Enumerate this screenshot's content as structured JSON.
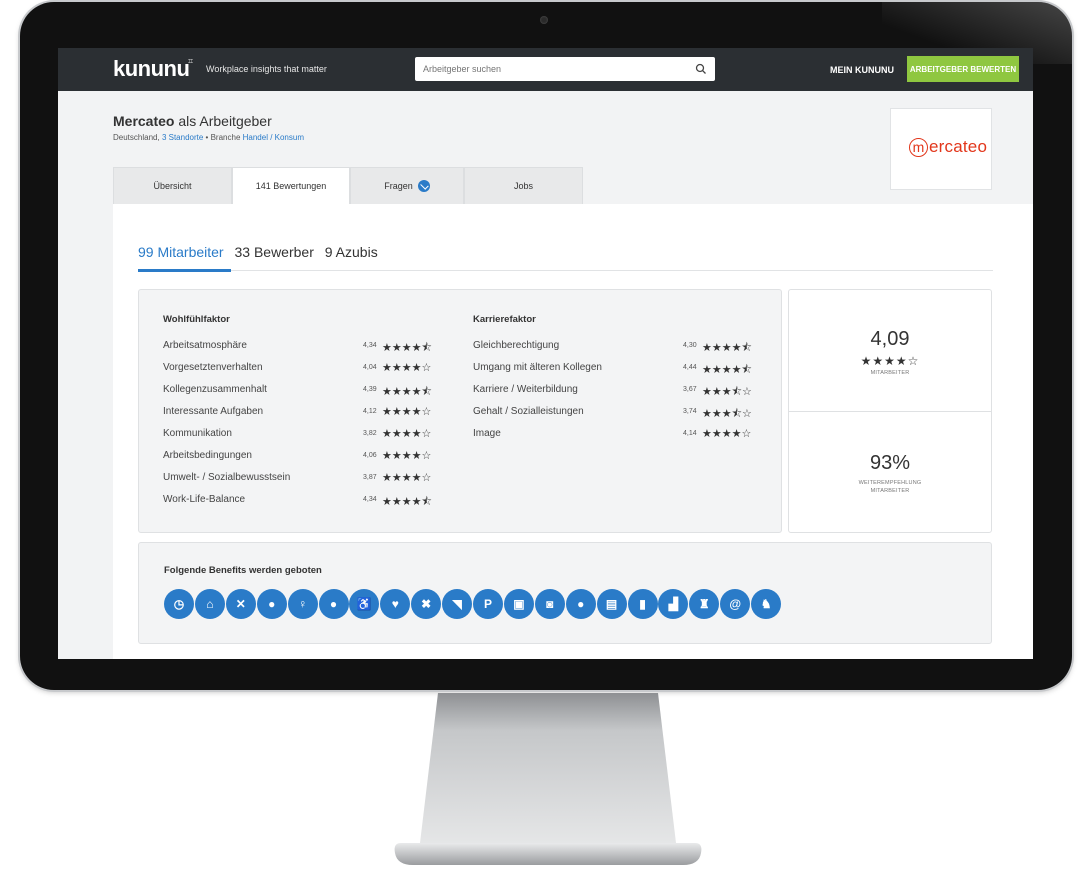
{
  "topbar": {
    "logo": "kununu",
    "logo_mark": "⌗",
    "tagline": "Workplace insights that matter",
    "search_placeholder": "Arbeitgeber suchen",
    "mein_kununu": "MEIN KUNUNU",
    "cta": "ARBEITGEBER BEWERTEN"
  },
  "company": {
    "name": "Mercateo",
    "suffix": "als Arbeitgeber",
    "country": "Deutschland,",
    "standorte": "3 Standorte",
    "separator": "•",
    "branche_label": "Branche",
    "branche": "Handel / Konsum",
    "logo_text": "ercateo",
    "logo_initial": "m"
  },
  "tabs": [
    {
      "label": "Übersicht"
    },
    {
      "label": "141 Bewertungen"
    },
    {
      "label": "Fragen"
    },
    {
      "label": "Jobs"
    }
  ],
  "subtabs": [
    {
      "label": "99 Mitarbeiter"
    },
    {
      "label": "33 Bewerber"
    },
    {
      "label": "9 Azubis"
    }
  ],
  "wohlfuehl": {
    "title": "Wohlfühlfaktor",
    "rows": [
      {
        "name": "Arbeitsatmosphäre",
        "value": "4,34",
        "stars": "★★★★⯪"
      },
      {
        "name": "Vorgesetztenverhalten",
        "value": "4,04",
        "stars": "★★★★☆"
      },
      {
        "name": "Kollegenzusammenhalt",
        "value": "4,39",
        "stars": "★★★★⯪"
      },
      {
        "name": "Interessante Aufgaben",
        "value": "4,12",
        "stars": "★★★★☆"
      },
      {
        "name": "Kommunikation",
        "value": "3,82",
        "stars": "★★★★☆"
      },
      {
        "name": "Arbeitsbedingungen",
        "value": "4,06",
        "stars": "★★★★☆"
      },
      {
        "name": "Umwelt- / Sozialbewusstsein",
        "value": "3,87",
        "stars": "★★★★☆"
      },
      {
        "name": "Work-Life-Balance",
        "value": "4,34",
        "stars": "★★★★⯪"
      }
    ]
  },
  "karriere": {
    "title": "Karrierefaktor",
    "rows": [
      {
        "name": "Gleichberechtigung",
        "value": "4,30",
        "stars": "★★★★⯪"
      },
      {
        "name": "Umgang mit älteren Kollegen",
        "value": "4,44",
        "stars": "★★★★⯪"
      },
      {
        "name": "Karriere / Weiterbildung",
        "value": "3,67",
        "stars": "★★★⯪☆"
      },
      {
        "name": "Gehalt / Sozialleistungen",
        "value": "3,74",
        "stars": "★★★⯪☆"
      },
      {
        "name": "Image",
        "value": "4,14",
        "stars": "★★★★☆"
      }
    ]
  },
  "overall": {
    "score": "4,09",
    "stars": "★★★★☆",
    "caption": "MITARBEITER",
    "recommend": "93%",
    "recommend_caption_1": "WEITEREMPFEHLUNG",
    "recommend_caption_2": "MITARBEITER"
  },
  "benefits": {
    "title": "Folgende Benefits werden geboten",
    "items": [
      {
        "icon": "clock-icon",
        "glyph": "◷"
      },
      {
        "icon": "home-icon",
        "glyph": "⌂"
      },
      {
        "icon": "cutlery-icon",
        "glyph": "✕"
      },
      {
        "icon": "health-icon",
        "glyph": "●"
      },
      {
        "icon": "childcare-icon",
        "glyph": "♀"
      },
      {
        "icon": "piggybank-icon",
        "glyph": "●"
      },
      {
        "icon": "accessibility-icon",
        "glyph": "♿"
      },
      {
        "icon": "heart-icon",
        "glyph": "♥"
      },
      {
        "icon": "discount-icon",
        "glyph": "✖"
      },
      {
        "icon": "coaching-icon",
        "glyph": "◥"
      },
      {
        "icon": "parking-icon",
        "glyph": "P"
      },
      {
        "icon": "public-transport-icon",
        "glyph": "▣"
      },
      {
        "icon": "coffee-icon",
        "glyph": "◙"
      },
      {
        "icon": "meals-icon",
        "glyph": "●"
      },
      {
        "icon": "company-car-icon",
        "glyph": "▤"
      },
      {
        "icon": "phone-icon",
        "glyph": "▮"
      },
      {
        "icon": "bonus-icon",
        "glyph": "▟"
      },
      {
        "icon": "events-icon",
        "glyph": "♜"
      },
      {
        "icon": "internet-icon",
        "glyph": "@"
      },
      {
        "icon": "dog-icon",
        "glyph": "♞"
      }
    ]
  },
  "colors": {
    "topbar": "#2b2f33",
    "accent": "#2a7bc8",
    "cta": "#8fc740",
    "brand_logo": "#e2361b"
  }
}
